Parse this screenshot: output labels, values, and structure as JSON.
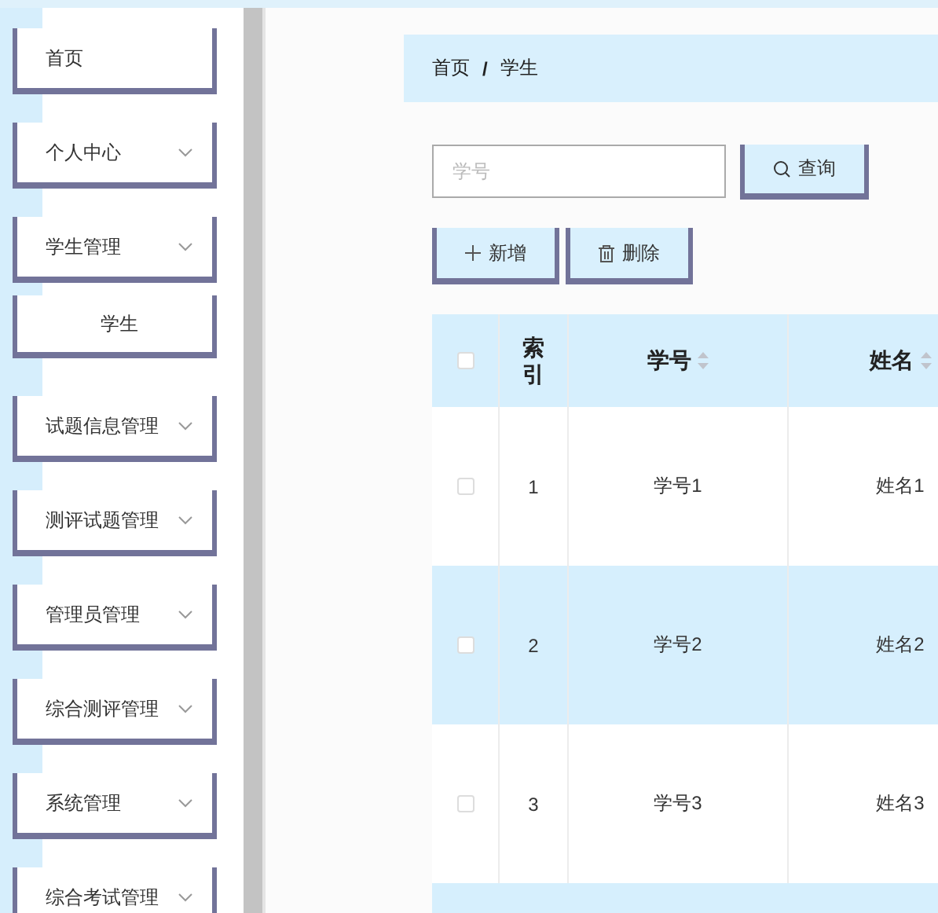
{
  "sidebar": {
    "items": [
      {
        "label": "首页",
        "kind": "link"
      },
      {
        "label": "个人中心",
        "kind": "submenu"
      },
      {
        "label": "学生管理",
        "kind": "submenu",
        "children": [
          {
            "label": "学生"
          }
        ]
      },
      {
        "label": "试题信息管理",
        "kind": "submenu"
      },
      {
        "label": "测评试题管理",
        "kind": "submenu"
      },
      {
        "label": "管理员管理",
        "kind": "submenu"
      },
      {
        "label": "综合测评管理",
        "kind": "submenu"
      },
      {
        "label": "系统管理",
        "kind": "submenu"
      },
      {
        "label": "综合考试管理",
        "kind": "submenu"
      }
    ]
  },
  "breadcrumb": [
    "首页",
    "/",
    "学生"
  ],
  "search": {
    "placeholder": "学号",
    "button": "查询"
  },
  "actions": [
    {
      "label": "新增",
      "kind": "add"
    },
    {
      "label": "删除",
      "kind": "delete"
    }
  ],
  "table": {
    "columns": [
      {
        "kind": "check",
        "checked": false
      },
      {
        "label": "索引",
        "kind": "text"
      },
      {
        "label": "学号",
        "kind": "sort"
      },
      {
        "label": "姓名",
        "kind": "sort"
      }
    ],
    "rows": [
      {
        "checked": false,
        "cells": [
          "",
          "1",
          "学号1",
          "姓名1"
        ]
      },
      {
        "checked": false,
        "cells": [
          "",
          "2",
          "学号2",
          "姓名2"
        ]
      },
      {
        "checked": false,
        "cells": [
          "",
          "3",
          "学号3",
          "姓名3"
        ]
      }
    ]
  }
}
